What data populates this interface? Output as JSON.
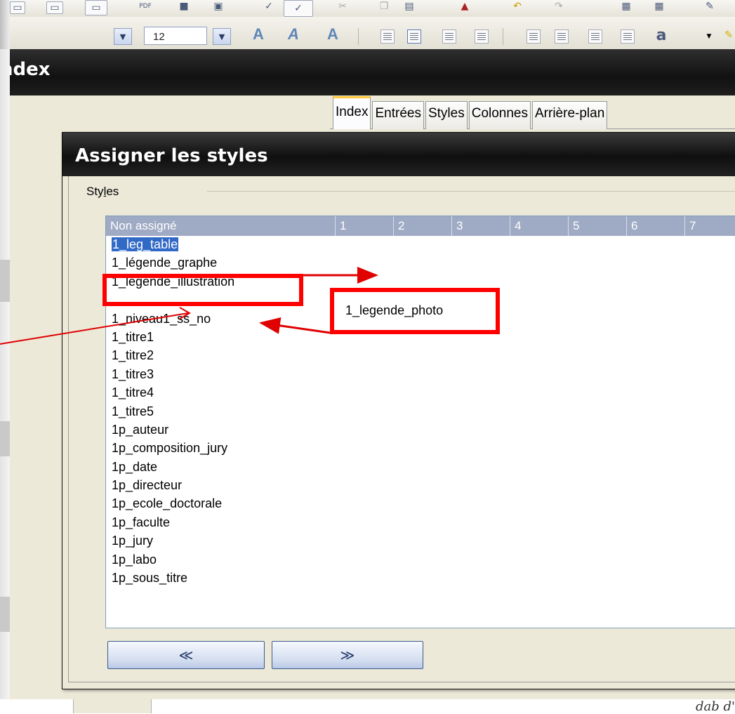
{
  "toolbar": {
    "font_size_value": "12"
  },
  "window": {
    "title": "ndex"
  },
  "tabs": [
    {
      "label": "Index",
      "active": true
    },
    {
      "label": "Entrées",
      "active": false
    },
    {
      "label": "Styles",
      "active": false
    },
    {
      "label": "Colonnes",
      "active": false
    },
    {
      "label": "Arrière-plan",
      "active": false
    }
  ],
  "dialog": {
    "title": "Assigner les styles",
    "group_label_pre": "Sty",
    "group_label_mnemonic": "l",
    "group_label_post": "es",
    "list": {
      "header": {
        "first": "Non assigné",
        "levels": [
          "1",
          "2",
          "3",
          "4",
          "5",
          "6",
          "7"
        ]
      },
      "items": [
        "1_leg_table",
        "1_légende_graphe",
        "1_legende_illustration",
        "",
        "1_niveau1_ss_no",
        "1_titre1",
        "1_titre2",
        "1_titre3",
        "1_titre4",
        "1_titre5",
        "1p_auteur",
        "1p_composition_jury",
        "1p_date",
        "1p_directeur",
        "1p_ecole_doctorale",
        "1p_faculte",
        "1p_jury",
        "1p_labo",
        "1p_sous_titre"
      ],
      "selected_index": 0
    },
    "buttons": {
      "left": "≪",
      "right": "≫"
    }
  },
  "annotation": {
    "callout_text": "1_legende_photo",
    "color": "#ff0000"
  },
  "footer": {
    "text": "dab d'"
  }
}
